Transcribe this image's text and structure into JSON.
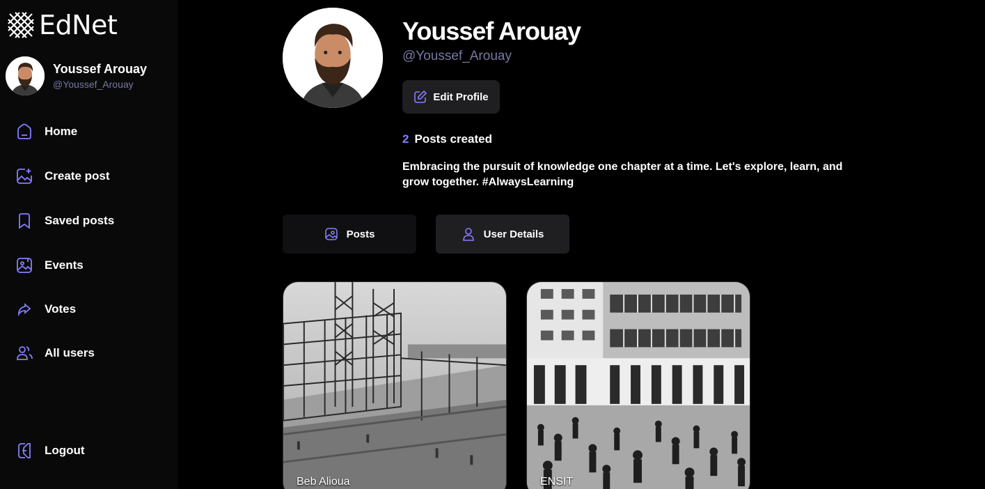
{
  "app": {
    "name": "EdNet"
  },
  "sidebar": {
    "user": {
      "name": "Youssef Arouay",
      "handle": "@Youssef_Arouay"
    },
    "items": [
      {
        "label": "Home",
        "icon": "home-icon"
      },
      {
        "label": "Create post",
        "icon": "create-post-icon"
      },
      {
        "label": "Saved posts",
        "icon": "bookmark-icon"
      },
      {
        "label": "Events",
        "icon": "events-icon"
      },
      {
        "label": "Votes",
        "icon": "share-icon"
      },
      {
        "label": "All users",
        "icon": "people-icon"
      }
    ],
    "logout": {
      "label": "Logout",
      "icon": "logout-icon"
    }
  },
  "profile": {
    "name": "Youssef Arouay",
    "handle": "@Youssef_Arouay",
    "edit_label": "Edit Profile",
    "posts_count": "2",
    "posts_label": "Posts created",
    "bio": "Embracing the pursuit of knowledge one chapter at a time. Let's explore, learn, and grow together. #AlwaysLearning"
  },
  "tabs": [
    {
      "label": "Posts",
      "icon": "image-icon"
    },
    {
      "label": "User Details",
      "icon": "user-icon"
    }
  ],
  "posts": [
    {
      "caption": "Beb Alioua"
    },
    {
      "caption": "ENSIT"
    }
  ],
  "colors": {
    "accent": "#877eff",
    "muted": "#7878a3",
    "background": "#000000",
    "sidebar": "#09090a",
    "button": "#1f1f22"
  }
}
